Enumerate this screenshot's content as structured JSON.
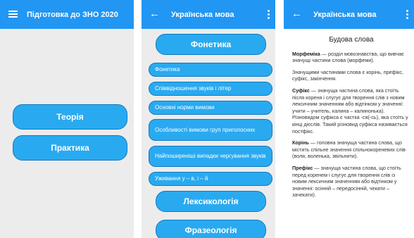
{
  "screen1": {
    "title": "Підготовка до ЗНО 2020",
    "buttons": [
      "Теорія",
      "Практика"
    ]
  },
  "screen2": {
    "title": "Українська мова",
    "sections": [
      "Фонетика",
      "Лексикологія",
      "Фразеологія"
    ],
    "topics": [
      "Фонетика",
      "Співвідношення звуків і літер",
      "Основні норми вимови",
      "Особливості вимови груп приголосних",
      "Найпоширеніші випадки чергування звуків",
      "Уживання у – в, і – й"
    ]
  },
  "screen3": {
    "title": "Українська мова",
    "heading": "Будова слова",
    "paragraphs": [
      {
        "term": "Морфеміка",
        "text": " — розділ мовознавства, що вивчає значущі частини слова (морфеми)."
      },
      {
        "term": "",
        "text": "Значущими частинами слова є корінь, префікс, суфікс, закінчення."
      },
      {
        "term": "Суфікс",
        "text": " — значуща частина слова, яка стоїть після кореня і слугує для творення слів з новим лексичним значенням або відтінком у значенні: учити – учитель, калина – калинонька). Різновидом суфікса є частка -ся(-сь), яка стоїть у кінці дієслів. Такий різновид суфікса називається постфікс."
      },
      {
        "term": "Корінь",
        "text": " — головна значуща частина слова, що містить спільне значення спільнокореневих слів (воля, воленька, звільнити)."
      },
      {
        "term": "Префікс",
        "text": " — значуща частина слова, що стоїть перед коренем і слугує для творення слів із новим лексичним значенням або відтінком у значенні: осінній – передосінній, чекати – зачекати)."
      }
    ]
  },
  "colors": {
    "appbar": "#2196f3",
    "button": "#29aaf0",
    "button_border": "#1479c0"
  },
  "icons": {
    "menu": "hamburger-menu-icon",
    "back": "arrow-back-icon",
    "more": "more-vert-icon"
  }
}
